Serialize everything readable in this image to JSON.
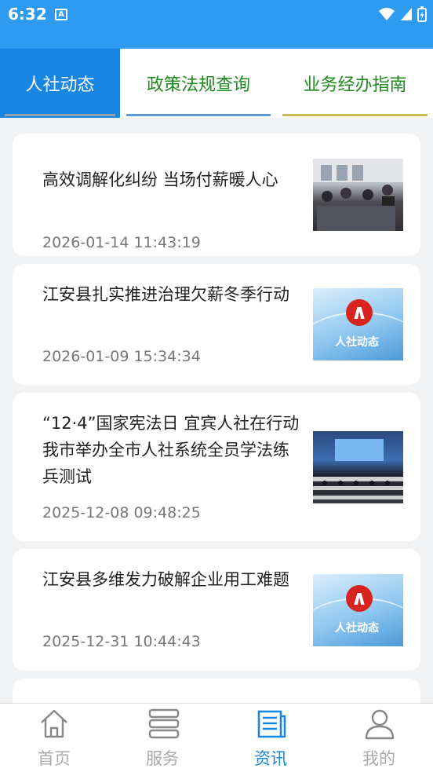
{
  "status_bar": {
    "time": "6:32",
    "notification_letter": "A"
  },
  "tabs": [
    {
      "label": "人社动态",
      "active": true
    },
    {
      "label": "政策法规查询",
      "active": false
    },
    {
      "label": "业务经办指南",
      "active": false
    }
  ],
  "articles": [
    {
      "title": "高效调解化纠纷 当场付薪暖人心",
      "time": "2026-01-14 11:43:19",
      "thumbnail": "meeting-photo"
    },
    {
      "title": "江安县扎实推进治理欠薪冬季行动",
      "time": "2026-01-09 15:34:34",
      "thumbnail": "renshe-logo",
      "thumbnail_text": "人社动态"
    },
    {
      "title": "“12·4”国家宪法日 宜宾人社在行动我市举办全市人社系统全员学法练兵测试",
      "time": "2025-12-08 09:48:25",
      "thumbnail": "auditorium-photo"
    },
    {
      "title": "江安县多维发力破解企业用工难题",
      "time": "2025-12-31 10:44:43",
      "thumbnail": "renshe-logo",
      "thumbnail_text": "人社动态"
    }
  ],
  "bottom_nav": [
    {
      "label": "首页",
      "icon": "home-icon",
      "active": false
    },
    {
      "label": "服务",
      "icon": "stack-icon",
      "active": false
    },
    {
      "label": "资讯",
      "icon": "news-icon",
      "active": true
    },
    {
      "label": "我的",
      "icon": "user-icon",
      "active": false
    }
  ],
  "colors": {
    "status_bar": "#2e9bf0",
    "active_tab": "#1a86e3",
    "tab_text": "#1f8a1f",
    "nav_active": "#1a86e3"
  }
}
